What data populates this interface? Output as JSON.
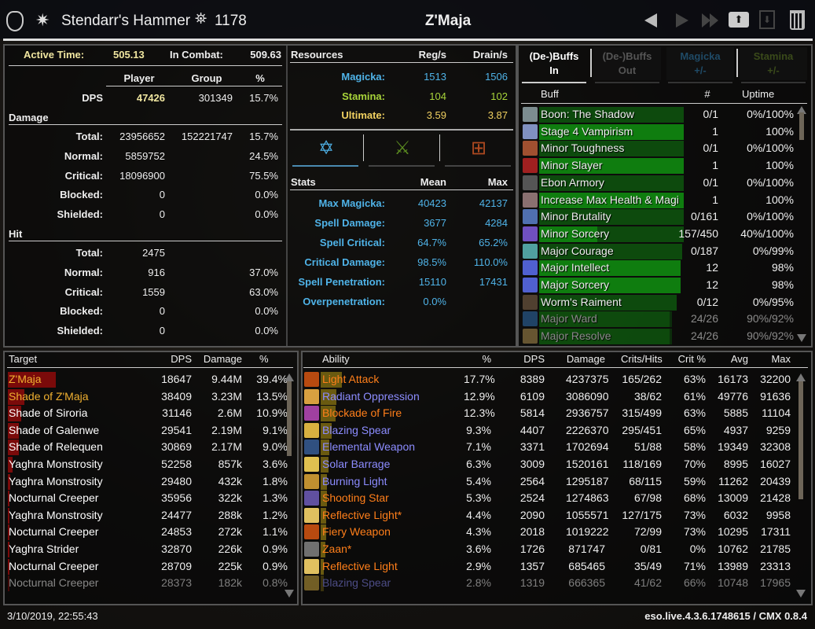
{
  "header": {
    "guild_name": "Stendarr's Hammer",
    "champion_points": "1178",
    "title": "Z'Maja",
    "icons": [
      "crest-icon",
      "champion-star-icon",
      "cp-icon",
      "prev-icon",
      "next-icon",
      "last-icon",
      "upload-icon",
      "save-icon",
      "delete-icon"
    ]
  },
  "overview": {
    "active_time_label": "Active Time:",
    "active_time": "505.13",
    "in_combat_label": "In Combat:",
    "in_combat": "509.63",
    "col_player": "Player",
    "col_group": "Group",
    "col_pct": "%",
    "dps": {
      "label": "DPS",
      "player": "47426",
      "group": "301349",
      "pct": "15.7%"
    },
    "damage_title": "Damage",
    "damage": [
      {
        "label": "Total:",
        "player": "23956652",
        "group": "152221747",
        "pct": "15.7%"
      },
      {
        "label": "Normal:",
        "player": "5859752",
        "group": "",
        "pct": "24.5%"
      },
      {
        "label": "Critical:",
        "player": "18096900",
        "group": "",
        "pct": "75.5%"
      },
      {
        "label": "Blocked:",
        "player": "0",
        "group": "",
        "pct": "0.0%"
      },
      {
        "label": "Shielded:",
        "player": "0",
        "group": "",
        "pct": "0.0%"
      }
    ],
    "hit_title": "Hit",
    "hit": [
      {
        "label": "Total:",
        "player": "2475",
        "group": "",
        "pct": ""
      },
      {
        "label": "Normal:",
        "player": "916",
        "group": "",
        "pct": "37.0%"
      },
      {
        "label": "Critical:",
        "player": "1559",
        "group": "",
        "pct": "63.0%"
      },
      {
        "label": "Blocked:",
        "player": "0",
        "group": "",
        "pct": "0.0%"
      },
      {
        "label": "Shielded:",
        "player": "0",
        "group": "",
        "pct": "0.0%"
      }
    ]
  },
  "resources": {
    "title": "Resources",
    "col_reg": "Reg/s",
    "col_drain": "Drain/s",
    "rows": [
      {
        "label": "Magicka:",
        "reg": "1513",
        "drain": "1506",
        "color": "#4fb3e8"
      },
      {
        "label": "Stamina:",
        "reg": "104",
        "drain": "102",
        "color": "#a8d43a"
      },
      {
        "label": "Ultimate:",
        "reg": "3.59",
        "drain": "3.87",
        "color": "#f0d060"
      }
    ],
    "tabs": [
      {
        "icon": "magicka-icon",
        "active": true
      },
      {
        "icon": "stamina-icon",
        "active": false
      },
      {
        "icon": "health-icon",
        "active": false
      }
    ]
  },
  "stats": {
    "title": "Stats",
    "col_mean": "Mean",
    "col_max": "Max",
    "rows": [
      {
        "label": "Max Magicka:",
        "mean": "40423",
        "max": "42137"
      },
      {
        "label": "Spell Damage:",
        "mean": "3677",
        "max": "4284"
      },
      {
        "label": "Spell Critical:",
        "mean": "64.7%",
        "max": "65.2%"
      },
      {
        "label": "Critical Damage:",
        "mean": "98.5%",
        "max": "110.0%"
      },
      {
        "label": "Spell Penetration:",
        "mean": "15110",
        "max": "17431"
      },
      {
        "label": "Overpenetration:",
        "mean": "0.0%",
        "max": ""
      }
    ],
    "color": "#4fb3e8"
  },
  "buffs": {
    "tabs": [
      {
        "line1": "(De-)Buffs",
        "line2": "In",
        "color": "#ffffff",
        "active": true
      },
      {
        "line1": "(De-)Buffs",
        "line2": "Out",
        "color": "#555555",
        "active": false
      },
      {
        "line1": "Magicka",
        "line2": "+/-",
        "color": "#1f4a66",
        "active": false
      },
      {
        "line1": "Stamina",
        "line2": "+/-",
        "color": "#3a4a1a",
        "active": false
      }
    ],
    "col_buff": "Buff",
    "col_count": "#",
    "col_uptime": "Uptime",
    "rows": [
      {
        "name": "Boon: The Shadow",
        "count": "0/1",
        "uptime": "0%/100%",
        "own": 0,
        "total": 100
      },
      {
        "name": "Stage 4 Vampirism",
        "count": "1",
        "uptime": "100%",
        "own": 100,
        "total": 100
      },
      {
        "name": "Minor Toughness",
        "count": "0/1",
        "uptime": "0%/100%",
        "own": 0,
        "total": 100
      },
      {
        "name": "Minor Slayer",
        "count": "1",
        "uptime": "100%",
        "own": 100,
        "total": 100
      },
      {
        "name": "Ebon Armory",
        "count": "0/1",
        "uptime": "0%/100%",
        "own": 0,
        "total": 100
      },
      {
        "name": "Increase Max Health & Magi",
        "count": "1",
        "uptime": "100%",
        "own": 100,
        "total": 100
      },
      {
        "name": "Minor Brutality",
        "count": "0/161",
        "uptime": "0%/100%",
        "own": 0,
        "total": 100
      },
      {
        "name": "Minor Sorcery",
        "count": "157/450",
        "uptime": "40%/100%",
        "own": 40,
        "total": 100
      },
      {
        "name": "Major Courage",
        "count": "0/187",
        "uptime": "0%/99%",
        "own": 0,
        "total": 99
      },
      {
        "name": "Major Intellect",
        "count": "12",
        "uptime": "98%",
        "own": 98,
        "total": 98
      },
      {
        "name": "Major Sorcery",
        "count": "12",
        "uptime": "98%",
        "own": 98,
        "total": 98
      },
      {
        "name": "Worm's Raiment",
        "count": "0/12",
        "uptime": "0%/95%",
        "own": 0,
        "total": 95
      },
      {
        "name": "Major Ward",
        "count": "24/26",
        "uptime": "90%/92%",
        "own": 90,
        "total": 92
      },
      {
        "name": "Major Resolve",
        "count": "24/26",
        "uptime": "90%/92%",
        "own": 90,
        "total": 92
      }
    ]
  },
  "targets": {
    "col_target": "Target",
    "col_dps": "DPS",
    "col_damage": "Damage",
    "col_pct": "%",
    "rows": [
      {
        "name": "Z'Maja",
        "dps": "18647",
        "damage": "9.44M",
        "pct": "39.4%",
        "value": 39.4,
        "color": "#f0b030"
      },
      {
        "name": "Shade of Z'Maja",
        "dps": "38409",
        "damage": "3.23M",
        "pct": "13.5%",
        "value": 13.5,
        "color": "#f0b030"
      },
      {
        "name": "Shade of Siroria",
        "dps": "31146",
        "damage": "2.6M",
        "pct": "10.9%",
        "value": 10.9,
        "color": "#ffffff"
      },
      {
        "name": "Shade of Galenwe",
        "dps": "29541",
        "damage": "2.19M",
        "pct": "9.1%",
        "value": 9.1,
        "color": "#ffffff"
      },
      {
        "name": "Shade of Relequen",
        "dps": "30869",
        "damage": "2.17M",
        "pct": "9.0%",
        "value": 9.0,
        "color": "#ffffff"
      },
      {
        "name": "Yaghra Monstrosity",
        "dps": "52258",
        "damage": "857k",
        "pct": "3.6%",
        "value": 3.6,
        "color": "#ffffff"
      },
      {
        "name": "Yaghra Monstrosity",
        "dps": "29480",
        "damage": "432k",
        "pct": "1.8%",
        "value": 1.8,
        "color": "#ffffff"
      },
      {
        "name": "Nocturnal Creeper",
        "dps": "35956",
        "damage": "322k",
        "pct": "1.3%",
        "value": 1.3,
        "color": "#ffffff"
      },
      {
        "name": "Yaghra Monstrosity",
        "dps": "24477",
        "damage": "288k",
        "pct": "1.2%",
        "value": 1.2,
        "color": "#ffffff"
      },
      {
        "name": "Nocturnal Creeper",
        "dps": "24853",
        "damage": "272k",
        "pct": "1.1%",
        "value": 1.1,
        "color": "#ffffff"
      },
      {
        "name": "Yaghra Strider",
        "dps": "32870",
        "damage": "226k",
        "pct": "0.9%",
        "value": 0.9,
        "color": "#ffffff"
      },
      {
        "name": "Nocturnal Creeper",
        "dps": "28709",
        "damage": "225k",
        "pct": "0.9%",
        "value": 0.9,
        "color": "#ffffff"
      },
      {
        "name": "Nocturnal Creeper",
        "dps": "28373",
        "damage": "182k",
        "pct": "0.8%",
        "value": 0.8,
        "color": "#ffffff"
      }
    ]
  },
  "abilities": {
    "cols": [
      "Ability",
      "%",
      "DPS",
      "Damage",
      "Crits/Hits",
      "Crit %",
      "Avg",
      "Max"
    ],
    "rows": [
      {
        "name": "Light Attack",
        "pct": "17.7%",
        "dps": "8389",
        "damage": "4237375",
        "crits": "165/262",
        "critp": "63%",
        "avg": "16173",
        "max": "32200",
        "value": 17.7,
        "color": "#ff7f1a",
        "icon": "#b84a10"
      },
      {
        "name": "Radiant Oppression",
        "pct": "12.9%",
        "dps": "6109",
        "damage": "3086090",
        "crits": "38/62",
        "critp": "61%",
        "avg": "49776",
        "max": "91636",
        "value": 12.9,
        "color": "#8c8cff",
        "icon": "#d8a040"
      },
      {
        "name": "Blockade of Fire",
        "pct": "12.3%",
        "dps": "5814",
        "damage": "2936757",
        "crits": "315/499",
        "critp": "63%",
        "avg": "5885",
        "max": "11104",
        "value": 12.3,
        "color": "#ff7f1a",
        "icon": "#a040a0"
      },
      {
        "name": "Blazing Spear",
        "pct": "9.3%",
        "dps": "4407",
        "damage": "2226370",
        "crits": "295/451",
        "critp": "65%",
        "avg": "4937",
        "max": "9259",
        "value": 9.3,
        "color": "#8c8cff",
        "icon": "#d8b040"
      },
      {
        "name": "Elemental Weapon",
        "pct": "7.1%",
        "dps": "3371",
        "damage": "1702694",
        "crits": "51/88",
        "critp": "58%",
        "avg": "19349",
        "max": "32308",
        "value": 7.1,
        "color": "#8c8cff",
        "icon": "#305080"
      },
      {
        "name": "Solar Barrage",
        "pct": "6.3%",
        "dps": "3009",
        "damage": "1520161",
        "crits": "118/169",
        "critp": "70%",
        "avg": "8995",
        "max": "16027",
        "value": 6.3,
        "color": "#8c8cff",
        "icon": "#e0c050"
      },
      {
        "name": "Burning Light",
        "pct": "5.4%",
        "dps": "2564",
        "damage": "1295187",
        "crits": "68/115",
        "critp": "59%",
        "avg": "11262",
        "max": "20439",
        "value": 5.4,
        "color": "#8c8cff",
        "icon": "#c09030"
      },
      {
        "name": "Shooting Star",
        "pct": "5.3%",
        "dps": "2524",
        "damage": "1274863",
        "crits": "67/98",
        "critp": "68%",
        "avg": "13009",
        "max": "21428",
        "value": 5.3,
        "color": "#ff7f1a",
        "icon": "#6050a0"
      },
      {
        "name": "Reflective Light*",
        "pct": "4.4%",
        "dps": "2090",
        "damage": "1055571",
        "crits": "127/175",
        "critp": "73%",
        "avg": "6032",
        "max": "9958",
        "value": 4.4,
        "color": "#ff7f1a",
        "icon": "#e0c060"
      },
      {
        "name": "Fiery Weapon",
        "pct": "4.3%",
        "dps": "2018",
        "damage": "1019222",
        "crits": "72/99",
        "critp": "73%",
        "avg": "10295",
        "max": "17311",
        "value": 4.3,
        "color": "#ff7f1a",
        "icon": "#b84a10"
      },
      {
        "name": "Zaan*",
        "pct": "3.6%",
        "dps": "1726",
        "damage": "871747",
        "crits": "0/81",
        "critp": "0%",
        "avg": "10762",
        "max": "21785",
        "value": 3.6,
        "color": "#ff7f1a",
        "icon": "#707070"
      },
      {
        "name": "Reflective Light",
        "pct": "2.9%",
        "dps": "1357",
        "damage": "685465",
        "crits": "35/49",
        "critp": "71%",
        "avg": "13989",
        "max": "23313",
        "value": 2.9,
        "color": "#ff7f1a",
        "icon": "#e0c060"
      },
      {
        "name": "Blazing Spear",
        "pct": "2.8%",
        "dps": "1319",
        "damage": "666365",
        "crits": "41/62",
        "critp": "66%",
        "avg": "10748",
        "max": "17965",
        "value": 2.8,
        "color": "#8c8cff",
        "icon": "#d8b040"
      }
    ]
  },
  "footer": {
    "timestamp": "3/10/2019, 22:55:43",
    "version": "eso.live.4.3.6.1748615 / CMX 0.8.4"
  }
}
